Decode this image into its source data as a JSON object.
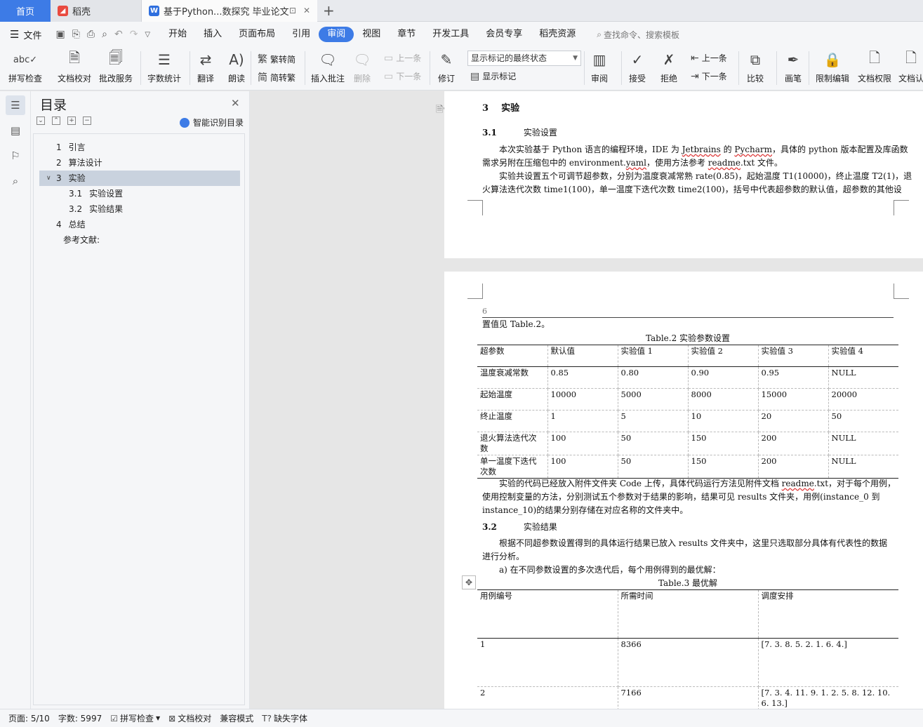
{
  "titlebar": {
    "home_tab": "首页",
    "daoke_tab": "稻壳",
    "doc_tab": "基于Python...数探究 毕业论文"
  },
  "menubar": {
    "file": "文件",
    "items": [
      "开始",
      "插入",
      "页面布局",
      "引用",
      "审阅",
      "视图",
      "章节",
      "开发工具",
      "会员专享",
      "稻壳资源"
    ],
    "active_index": 4,
    "search_placeholder": "查找命令、搜索模板"
  },
  "ribbon": {
    "spell_check": "拼写检查",
    "doc_proof": "文档校对",
    "revise_service": "批改服务",
    "word_count": "字数统计",
    "translate": "翻译",
    "read_aloud": "朗读",
    "trad_to_simp": "繁转简",
    "simp_to_trad": "简转繁",
    "insert_comment": "插入批注",
    "delete": "删除",
    "prev_comment": "上一条",
    "next_comment": "下一条",
    "track_changes": "修订",
    "markup_state": "显示标记的最终状态",
    "show_markup": "显示标记",
    "review_pane": "审阅",
    "accept": "接受",
    "reject": "拒绝",
    "prev_change": "上一条",
    "next_change": "下一条",
    "compare": "比较",
    "pen": "画笔",
    "restrict_edit": "限制编辑",
    "doc_permission": "文档权限",
    "doc_cert": "文档认"
  },
  "toc": {
    "title": "目录",
    "smart_label": "智能识别目录",
    "items": [
      {
        "num": "1",
        "label": "引言",
        "level": 1
      },
      {
        "num": "2",
        "label": "算法设计",
        "level": 1
      },
      {
        "num": "3",
        "label": "实验",
        "level": 1
      },
      {
        "num": "3.1",
        "label": "实验设置",
        "level": 2
      },
      {
        "num": "3.2",
        "label": "实验结果",
        "level": 2
      },
      {
        "num": "4",
        "label": "总结",
        "level": 1
      },
      {
        "num": "",
        "label": "参考文献:",
        "level": 1
      }
    ]
  },
  "doc": {
    "p1_heading_num": "3",
    "p1_heading": "实验",
    "p1_sub_num": "3.1",
    "p1_sub": "实验设置",
    "p1_line1_a": "本次实验基于 Python 语言的编程环境，IDE 为 ",
    "p1_line1_b": "Jetbrains",
    "p1_line1_c": " 的 ",
    "p1_line1_d": "Pycharm",
    "p1_line1_e": "，具体的 python 版本配置及库函数",
    "p1_line2_a": "需求另附在压缩包中的 environment.",
    "p1_line2_b": "yaml",
    "p1_line2_c": "，使用方法参考 ",
    "p1_line2_d": "readme",
    "p1_line2_e": ".txt 文件。",
    "p1_line3": "实验共设置五个可调节超参数，分别为温度衰减常熟 rate(0.85)，起始温度 T1(10000)，终止温度 T2(1)，退",
    "p1_line4": "火算法迭代次数 time1(100)，单一温度下迭代次数 time2(100)，括号中代表超参数的默认值，超参数的其他设",
    "p2_page_num": "6",
    "p2_line0": "置值见 Table.2。",
    "table2_caption": "Table.2  实验参数设置",
    "table2": {
      "headers": [
        "超参数",
        "默认值",
        "实验值 1",
        "实验值 2",
        "实验值 3",
        "实验值 4"
      ],
      "rows": [
        [
          "温度衰减常数",
          "0.85",
          "0.80",
          "0.90",
          "0.95",
          "NULL"
        ],
        [
          "起始温度",
          "10000",
          "5000",
          "8000",
          "15000",
          "20000"
        ],
        [
          "终止温度",
          "1",
          "5",
          "10",
          "20",
          "50"
        ],
        [
          "退火算法迭代次数",
          "100",
          "50",
          "150",
          "200",
          "NULL"
        ],
        [
          "单一温度下迭代次数",
          "100",
          "50",
          "150",
          "200",
          "NULL"
        ]
      ]
    },
    "p2_line1_a": "实验的代码已经放入附件文件夹 Code 上传，具体代码运行方法见附件文档 ",
    "p2_line1_b": "readme",
    "p2_line1_c": ".txt，对于每个用例，",
    "p2_line2": "使用控制变量的方法，分别测试五个参数对于结果的影响，结果可见 results 文件夹，用例(instance_0  到",
    "p2_line3": "instance_10)的结果分别存储在对应名称的文件夹中。",
    "p2_sub_num": "3.2",
    "p2_sub": "实验结果",
    "p2_line4": "根据不同超参数设置得到的具体运行结果已放入 results 文件夹中，这里只选取部分具体有代表性的数据",
    "p2_line5": "进行分析。",
    "p2_line6": "a)  在不同参数设置的多次迭代后，每个用例得到的最优解：",
    "table3_caption": "Table.3  最优解",
    "table3": {
      "headers": [
        "用例编号",
        "所需时间",
        "调度安排"
      ],
      "rows": [
        [
          "1",
          "8366",
          "[7. 3. 8. 5. 2. 1. 6. 4.]"
        ],
        [
          "2",
          "7166",
          "[7. 3. 4. 11. 9. 1. 2. 5. 8. 12. 10. 6. 13.]"
        ]
      ]
    }
  },
  "status": {
    "page": "页面: 5/10",
    "words": "字数: 5997",
    "spell": "拼写检查",
    "proof": "文档校对",
    "compat": "兼容模式",
    "missing_font": "缺失字体"
  },
  "colors": {
    "accent": "#3d7be6",
    "tab_bar": "#e8eaee"
  }
}
